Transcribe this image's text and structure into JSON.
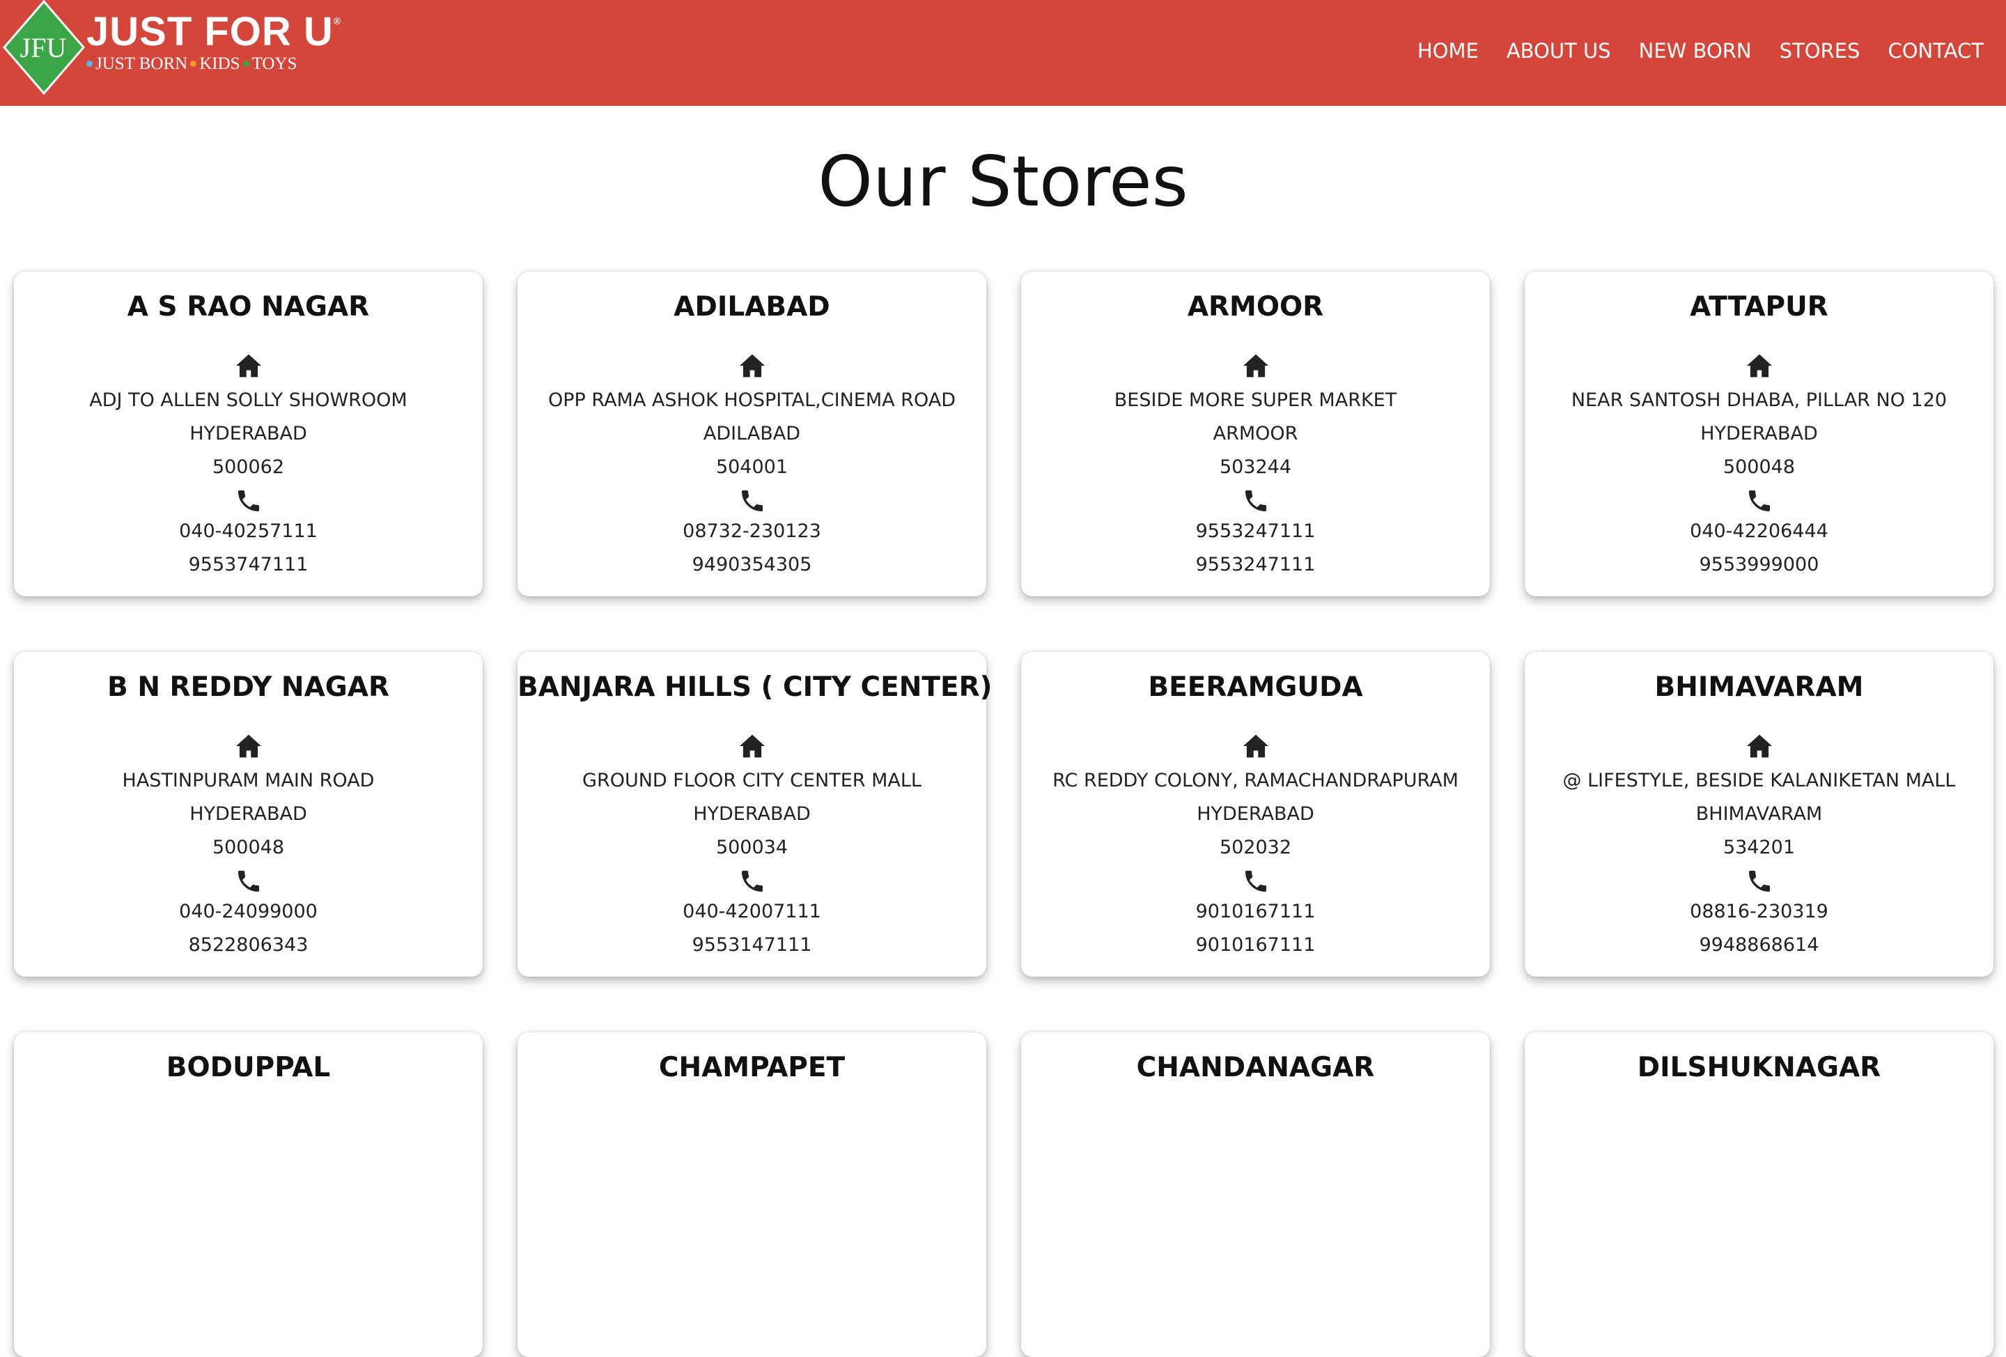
{
  "brand": {
    "mark": "JFU",
    "title": "JUST FOR U",
    "registered": "®",
    "tagline": [
      "JUST BORN",
      "KIDS",
      "TOYS"
    ],
    "colors": {
      "header": "#d4463a",
      "mark_green": "#3aa646",
      "dot_blue": "#5ab4e6",
      "dot_orange": "#f39a2e",
      "dot_green": "#3aa646"
    }
  },
  "nav": [
    {
      "label": "HOME"
    },
    {
      "label": "ABOUT US"
    },
    {
      "label": "NEW BORN"
    },
    {
      "label": "STORES"
    },
    {
      "label": "CONTACT"
    }
  ],
  "page": {
    "title": "Our Stores"
  },
  "icons": {
    "address": "home-icon",
    "phone": "phone-icon"
  },
  "stores": [
    {
      "name": "A S RAO NAGAR",
      "address": "ADJ TO ALLEN SOLLY SHOWROOM",
      "city": "HYDERABAD",
      "pincode": "500062",
      "phone1": "040-40257111",
      "phone2": "9553747111"
    },
    {
      "name": "ADILABAD",
      "address": "OPP RAMA ASHOK HOSPITAL,CINEMA ROAD",
      "city": "ADILABAD",
      "pincode": "504001",
      "phone1": "08732-230123",
      "phone2": "9490354305"
    },
    {
      "name": "ARMOOR",
      "address": "BESIDE MORE SUPER MARKET",
      "city": "ARMOOR",
      "pincode": "503244",
      "phone1": "9553247111",
      "phone2": "9553247111"
    },
    {
      "name": "ATTAPUR",
      "address": "NEAR SANTOSH DHABA, PILLAR NO 120",
      "city": "HYDERABAD",
      "pincode": "500048",
      "phone1": "040-42206444",
      "phone2": "9553999000"
    },
    {
      "name": "B N REDDY NAGAR",
      "address": "HASTINPURAM MAIN ROAD",
      "city": "HYDERABAD",
      "pincode": "500048",
      "phone1": "040-24099000",
      "phone2": "8522806343"
    },
    {
      "name": "BANJARA HILLS ( CITY CENTER)",
      "address": "GROUND FLOOR CITY CENTER MALL",
      "city": "HYDERABAD",
      "pincode": "500034",
      "phone1": "040-42007111",
      "phone2": "9553147111"
    },
    {
      "name": "BEERAMGUDA",
      "address": "RC REDDY COLONY, RAMACHANDRAPURAM",
      "city": "HYDERABAD",
      "pincode": "502032",
      "phone1": "9010167111",
      "phone2": "9010167111"
    },
    {
      "name": "BHIMAVARAM",
      "address": "@ LIFESTYLE, BESIDE KALANIKETAN MALL",
      "city": "BHIMAVARAM",
      "pincode": "534201",
      "phone1": "08816-230319",
      "phone2": "9948868614"
    },
    {
      "name": "BODUPPAL"
    },
    {
      "name": "CHAMPAPET"
    },
    {
      "name": "CHANDANAGAR"
    },
    {
      "name": "DILSHUKNAGAR"
    }
  ]
}
